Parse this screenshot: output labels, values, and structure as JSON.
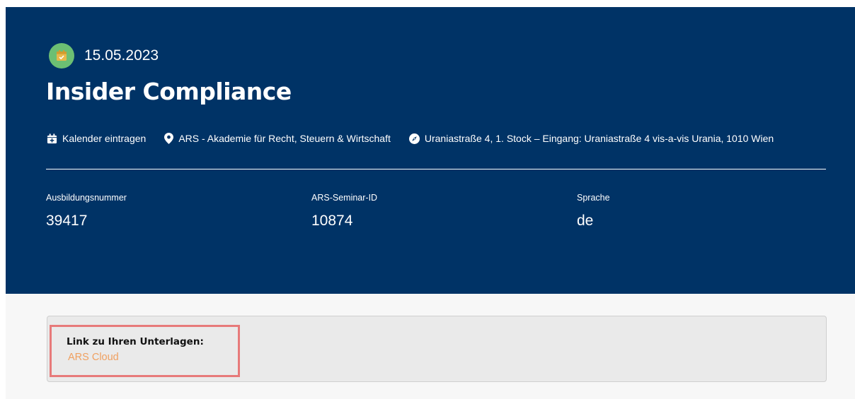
{
  "event": {
    "date": "15.05.2023",
    "title": "Insider Compliance",
    "meta": {
      "calendar_label": "Kalender eintragen",
      "organizer": "ARS - Akademie für Recht, Steuern & Wirtschaft",
      "address": "Uraniastraße 4, 1. Stock – Eingang: Uraniastraße 4 vis-a-vis Urania, 1010 Wien"
    },
    "facts": [
      {
        "label": "Ausbildungsnummer",
        "value": "39417"
      },
      {
        "label": "ARS-Seminar-ID",
        "value": "10874"
      },
      {
        "label": "Sprache",
        "value": "de"
      }
    ]
  },
  "documents": {
    "label": "Link zu Ihren Unterlagen:",
    "link_text": "ARS Cloud"
  },
  "colors": {
    "hero_bg": "#003366",
    "badge_green": "#6cbf73",
    "link_orange": "#f0a060",
    "highlight_red": "#e77a7a"
  },
  "icons": {
    "date": "calendar-check-icon",
    "calendar": "calendar-plus-icon",
    "organizer": "map-pin-icon",
    "address": "compass-icon"
  }
}
